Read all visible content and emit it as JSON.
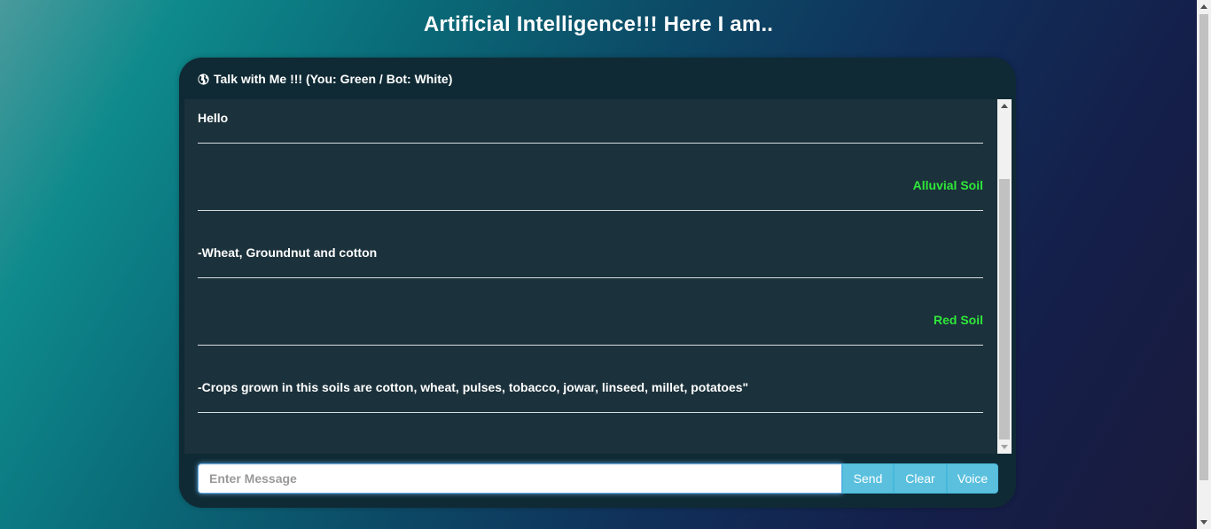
{
  "page": {
    "title": "Artificial Intelligence!!! Here I am.."
  },
  "chat": {
    "header_icon": "globe-icon",
    "header_title": "Talk with Me !!! (You: Green / Bot: White)",
    "messages": [
      {
        "sender": "bot",
        "text": "Hello"
      },
      {
        "sender": "user",
        "text": "Alluvial Soil"
      },
      {
        "sender": "bot",
        "text": "-Wheat, Groundnut and cotton"
      },
      {
        "sender": "user",
        "text": "Red Soil"
      },
      {
        "sender": "bot",
        "text": "-Crops grown in this soils are cotton, wheat, pulses, tobacco, jowar, linseed, millet, potatoes\""
      }
    ],
    "input": {
      "placeholder": "Enter Message",
      "value": ""
    },
    "buttons": {
      "send": "Send",
      "clear": "Clear",
      "voice": "Voice"
    }
  },
  "colors": {
    "user_text": "#2fe83a",
    "bot_text": "#ffffff",
    "button_bg": "#5bc0de",
    "panel_bg": "#0f2a34",
    "messages_bg": "#1b313b"
  }
}
